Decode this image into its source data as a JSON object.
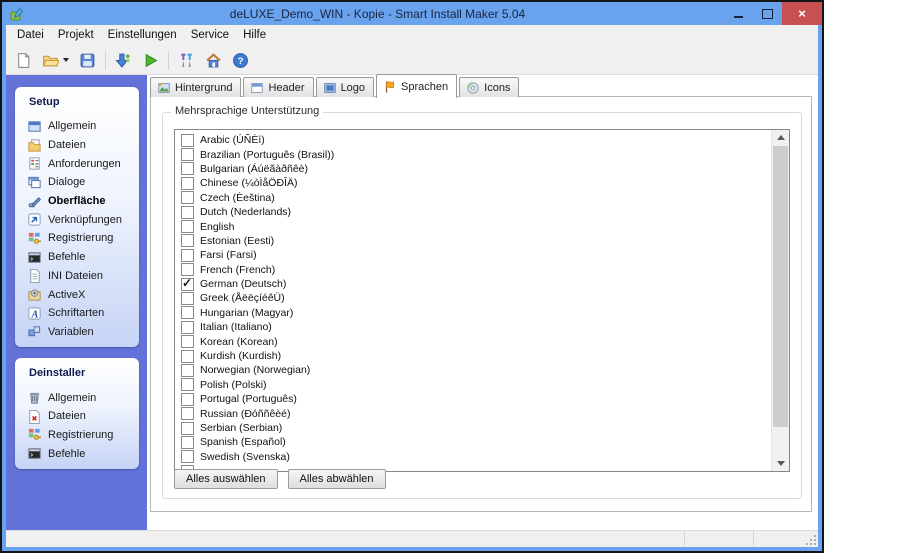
{
  "window": {
    "title": "deLUXE_Demo_WIN - Kopie - Smart Install Maker 5.04",
    "close_glyph": "×"
  },
  "menu": {
    "items": [
      "Datei",
      "Projekt",
      "Einstellungen",
      "Service",
      "Hilfe"
    ]
  },
  "toolbar": {
    "buttons": [
      {
        "name": "new-project-button",
        "icon": "new-file-icon"
      },
      {
        "name": "open-project-button",
        "icon": "open-folder-icon",
        "dropdown": true
      },
      {
        "name": "save-project-button",
        "icon": "save-icon"
      },
      {
        "sep": true
      },
      {
        "name": "compile-button",
        "icon": "compile-icon"
      },
      {
        "name": "run-button",
        "icon": "run-icon"
      },
      {
        "sep": true
      },
      {
        "name": "tools-button",
        "icon": "tools-icon"
      },
      {
        "name": "home-button",
        "icon": "home-icon"
      },
      {
        "name": "help-button",
        "icon": "help-icon"
      }
    ]
  },
  "sidebar": {
    "sections": [
      {
        "title": "Setup",
        "items": [
          {
            "label": "Allgemein",
            "icon": "general-icon"
          },
          {
            "label": "Dateien",
            "icon": "files-icon"
          },
          {
            "label": "Anforderungen",
            "icon": "requirements-icon"
          },
          {
            "label": "Dialoge",
            "icon": "dialogs-icon"
          },
          {
            "label": "Oberfläche",
            "icon": "interface-icon",
            "selected": true
          },
          {
            "label": "Verknüpfungen",
            "icon": "shortcuts-icon"
          },
          {
            "label": "Registrierung",
            "icon": "registry-icon"
          },
          {
            "label": "Befehle",
            "icon": "commands-icon"
          },
          {
            "label": "INI Dateien",
            "icon": "ini-files-icon"
          },
          {
            "label": "ActiveX",
            "icon": "activex-icon"
          },
          {
            "label": "Schriftarten",
            "icon": "fonts-icon"
          },
          {
            "label": "Variablen",
            "icon": "variables-icon"
          }
        ]
      },
      {
        "title": "Deinstaller",
        "items": [
          {
            "label": "Allgemein",
            "icon": "uninstall-general-icon"
          },
          {
            "label": "Dateien",
            "icon": "uninstall-files-icon"
          },
          {
            "label": "Registrierung",
            "icon": "registry-icon"
          },
          {
            "label": "Befehle",
            "icon": "commands-icon"
          }
        ]
      }
    ]
  },
  "tabs": {
    "items": [
      {
        "label": "Hintergrund",
        "icon": "background-tab-icon"
      },
      {
        "label": "Header",
        "icon": "header-tab-icon"
      },
      {
        "label": "Logo",
        "icon": "logo-tab-icon"
      },
      {
        "label": "Sprachen",
        "icon": "languages-tab-icon",
        "active": true
      },
      {
        "label": "Icons",
        "icon": "icons-tab-icon"
      }
    ]
  },
  "content": {
    "groupbox_title": "Mehrsprachige Unterstützung",
    "select_all_label": "Alles auswählen",
    "deselect_all_label": "Alles abwählen",
    "languages": [
      {
        "label": "Arabic (ÚÑÈì)",
        "checked": false
      },
      {
        "label": "Brazilian (Português (Brasil))",
        "checked": false
      },
      {
        "label": "Bulgarian (Áúëãàðñêè)",
        "checked": false
      },
      {
        "label": "Chinese (¼òÌåÖÐÎÄ)",
        "checked": false
      },
      {
        "label": "Czech (Èeština)",
        "checked": false
      },
      {
        "label": "Dutch (Nederlands)",
        "checked": false
      },
      {
        "label": "English",
        "checked": false
      },
      {
        "label": "Estonian (Eesti)",
        "checked": false
      },
      {
        "label": "Farsi (Farsi)",
        "checked": false
      },
      {
        "label": "French (French)",
        "checked": false
      },
      {
        "label": "German (Deutsch)",
        "checked": true
      },
      {
        "label": "Greek (ÅëëçíéêÜ)",
        "checked": false
      },
      {
        "label": "Hungarian (Magyar)",
        "checked": false
      },
      {
        "label": "Italian (Italiano)",
        "checked": false
      },
      {
        "label": "Korean (Korean)",
        "checked": false
      },
      {
        "label": "Kurdish (Kurdish)",
        "checked": false
      },
      {
        "label": "Norwegian (Norwegian)",
        "checked": false
      },
      {
        "label": "Polish (Polski)",
        "checked": false
      },
      {
        "label": "Portugal (Português)",
        "checked": false
      },
      {
        "label": "Russian (Ðóññêèé)",
        "checked": false
      },
      {
        "label": "Serbian (Serbian)",
        "checked": false
      },
      {
        "label": "Spanish (Español)",
        "checked": false
      },
      {
        "label": "Swedish (Svenska)",
        "checked": false
      },
      {
        "label": "",
        "checked": false,
        "partial": true
      }
    ]
  },
  "colors": {
    "titlebar_blue": "#69a3ee",
    "sidebar_blue": "#6272d8",
    "close_red": "#c75050",
    "panel_gradient_end": "#c5d3f5"
  }
}
